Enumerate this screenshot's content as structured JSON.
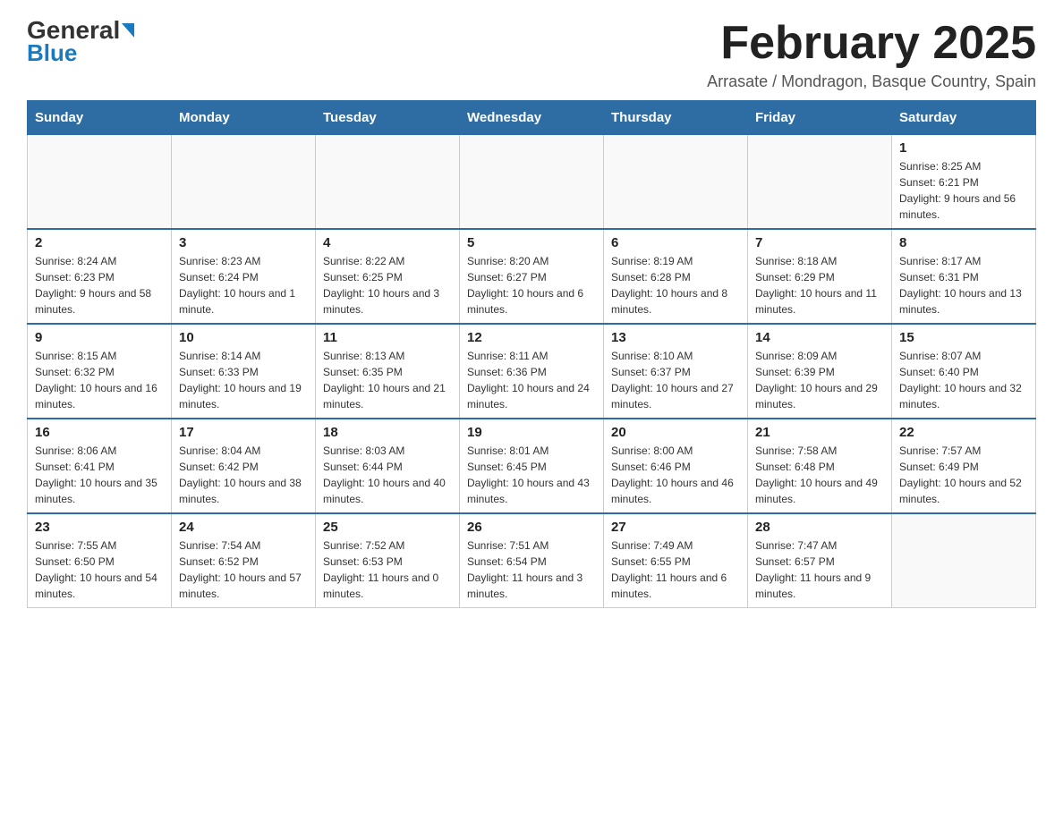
{
  "header": {
    "logo_general": "General",
    "logo_blue": "Blue",
    "month_title": "February 2025",
    "location": "Arrasate / Mondragon, Basque Country, Spain"
  },
  "weekdays": [
    "Sunday",
    "Monday",
    "Tuesday",
    "Wednesday",
    "Thursday",
    "Friday",
    "Saturday"
  ],
  "weeks": [
    [
      {
        "day": "",
        "info": ""
      },
      {
        "day": "",
        "info": ""
      },
      {
        "day": "",
        "info": ""
      },
      {
        "day": "",
        "info": ""
      },
      {
        "day": "",
        "info": ""
      },
      {
        "day": "",
        "info": ""
      },
      {
        "day": "1",
        "info": "Sunrise: 8:25 AM\nSunset: 6:21 PM\nDaylight: 9 hours and 56 minutes."
      }
    ],
    [
      {
        "day": "2",
        "info": "Sunrise: 8:24 AM\nSunset: 6:23 PM\nDaylight: 9 hours and 58 minutes."
      },
      {
        "day": "3",
        "info": "Sunrise: 8:23 AM\nSunset: 6:24 PM\nDaylight: 10 hours and 1 minute."
      },
      {
        "day": "4",
        "info": "Sunrise: 8:22 AM\nSunset: 6:25 PM\nDaylight: 10 hours and 3 minutes."
      },
      {
        "day": "5",
        "info": "Sunrise: 8:20 AM\nSunset: 6:27 PM\nDaylight: 10 hours and 6 minutes."
      },
      {
        "day": "6",
        "info": "Sunrise: 8:19 AM\nSunset: 6:28 PM\nDaylight: 10 hours and 8 minutes."
      },
      {
        "day": "7",
        "info": "Sunrise: 8:18 AM\nSunset: 6:29 PM\nDaylight: 10 hours and 11 minutes."
      },
      {
        "day": "8",
        "info": "Sunrise: 8:17 AM\nSunset: 6:31 PM\nDaylight: 10 hours and 13 minutes."
      }
    ],
    [
      {
        "day": "9",
        "info": "Sunrise: 8:15 AM\nSunset: 6:32 PM\nDaylight: 10 hours and 16 minutes."
      },
      {
        "day": "10",
        "info": "Sunrise: 8:14 AM\nSunset: 6:33 PM\nDaylight: 10 hours and 19 minutes."
      },
      {
        "day": "11",
        "info": "Sunrise: 8:13 AM\nSunset: 6:35 PM\nDaylight: 10 hours and 21 minutes."
      },
      {
        "day": "12",
        "info": "Sunrise: 8:11 AM\nSunset: 6:36 PM\nDaylight: 10 hours and 24 minutes."
      },
      {
        "day": "13",
        "info": "Sunrise: 8:10 AM\nSunset: 6:37 PM\nDaylight: 10 hours and 27 minutes."
      },
      {
        "day": "14",
        "info": "Sunrise: 8:09 AM\nSunset: 6:39 PM\nDaylight: 10 hours and 29 minutes."
      },
      {
        "day": "15",
        "info": "Sunrise: 8:07 AM\nSunset: 6:40 PM\nDaylight: 10 hours and 32 minutes."
      }
    ],
    [
      {
        "day": "16",
        "info": "Sunrise: 8:06 AM\nSunset: 6:41 PM\nDaylight: 10 hours and 35 minutes."
      },
      {
        "day": "17",
        "info": "Sunrise: 8:04 AM\nSunset: 6:42 PM\nDaylight: 10 hours and 38 minutes."
      },
      {
        "day": "18",
        "info": "Sunrise: 8:03 AM\nSunset: 6:44 PM\nDaylight: 10 hours and 40 minutes."
      },
      {
        "day": "19",
        "info": "Sunrise: 8:01 AM\nSunset: 6:45 PM\nDaylight: 10 hours and 43 minutes."
      },
      {
        "day": "20",
        "info": "Sunrise: 8:00 AM\nSunset: 6:46 PM\nDaylight: 10 hours and 46 minutes."
      },
      {
        "day": "21",
        "info": "Sunrise: 7:58 AM\nSunset: 6:48 PM\nDaylight: 10 hours and 49 minutes."
      },
      {
        "day": "22",
        "info": "Sunrise: 7:57 AM\nSunset: 6:49 PM\nDaylight: 10 hours and 52 minutes."
      }
    ],
    [
      {
        "day": "23",
        "info": "Sunrise: 7:55 AM\nSunset: 6:50 PM\nDaylight: 10 hours and 54 minutes."
      },
      {
        "day": "24",
        "info": "Sunrise: 7:54 AM\nSunset: 6:52 PM\nDaylight: 10 hours and 57 minutes."
      },
      {
        "day": "25",
        "info": "Sunrise: 7:52 AM\nSunset: 6:53 PM\nDaylight: 11 hours and 0 minutes."
      },
      {
        "day": "26",
        "info": "Sunrise: 7:51 AM\nSunset: 6:54 PM\nDaylight: 11 hours and 3 minutes."
      },
      {
        "day": "27",
        "info": "Sunrise: 7:49 AM\nSunset: 6:55 PM\nDaylight: 11 hours and 6 minutes."
      },
      {
        "day": "28",
        "info": "Sunrise: 7:47 AM\nSunset: 6:57 PM\nDaylight: 11 hours and 9 minutes."
      },
      {
        "day": "",
        "info": ""
      }
    ]
  ]
}
